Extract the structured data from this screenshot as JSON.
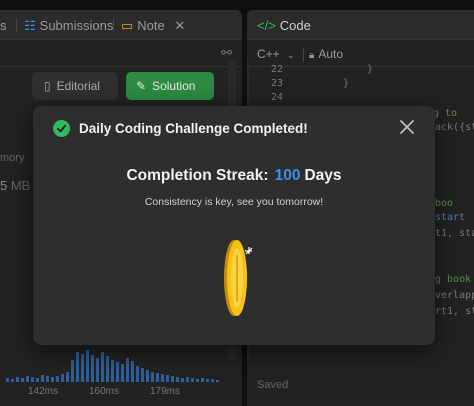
{
  "left_panel": {
    "tabs": {
      "first_partial": "s",
      "submissions": "Submissions",
      "note": "Note"
    },
    "buttons": {
      "editorial": "Editorial",
      "solution": "Solution"
    },
    "faded": {
      "memory": "mory",
      "mb": "MB"
    },
    "chart_axis": [
      "142ms",
      "160ms",
      "179ms"
    ]
  },
  "right_panel": {
    "title": "Code",
    "language": "C++",
    "mode": "Auto",
    "line_numbers": [
      "22",
      "23",
      "24"
    ],
    "code_fragments": [
      "}",
      "}",
      "g to",
      "ack({st",
      "boo",
      "start",
      "t1, sta",
      "g book",
      "verlapp",
      "rt1, st"
    ],
    "status": "Saved"
  },
  "modal": {
    "title": "Daily Coding Challenge Completed!",
    "streak_label": "Completion Streak:",
    "streak_value": "100",
    "streak_unit": "Days",
    "subtitle": "Consistency is key, see you tomorrow!",
    "colors": {
      "accent": "#3b8fe6",
      "success": "#2cbb5d",
      "coin": "#f5c21b"
    }
  }
}
